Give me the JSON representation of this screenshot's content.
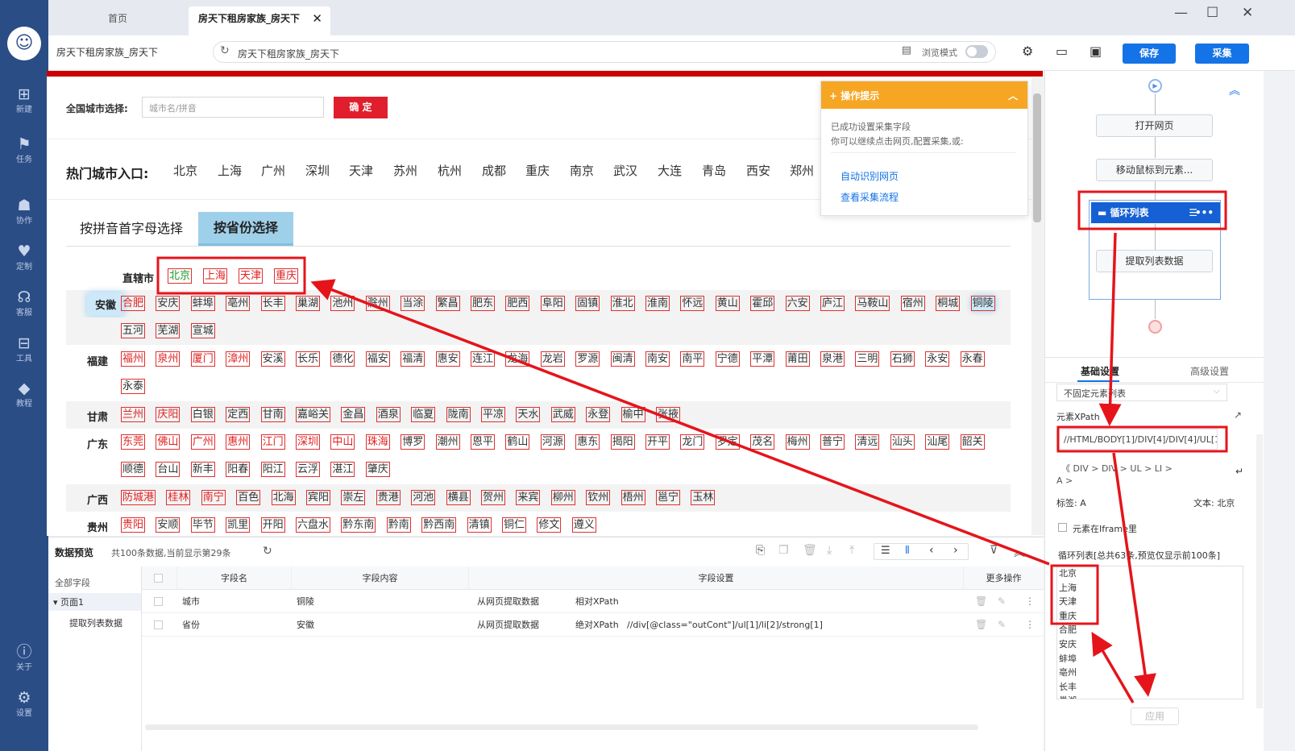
{
  "app": {
    "rail": [
      {
        "icon": "new-icon",
        "glyph": "⊞",
        "label": "新建"
      },
      {
        "icon": "task-icon",
        "glyph": "⚑",
        "label": "任务"
      },
      {
        "icon": "collab-icon",
        "glyph": "☗",
        "label": "协作"
      },
      {
        "icon": "custom-icon",
        "glyph": "♥",
        "label": "定制"
      },
      {
        "icon": "support-icon",
        "glyph": "☊",
        "label": "客服"
      },
      {
        "icon": "tools-icon",
        "glyph": "⊟",
        "label": "工具"
      },
      {
        "icon": "tutorial-icon",
        "glyph": "◆",
        "label": "教程"
      },
      {
        "icon": "about-icon",
        "glyph": "ⓘ",
        "label": "关于"
      },
      {
        "icon": "settings-icon",
        "glyph": "⚙",
        "label": "设置"
      }
    ],
    "tabs": [
      {
        "label": "首页"
      },
      {
        "label": "房天下租房家族_房天下"
      }
    ],
    "page_name": "房天下租房家族_房天下",
    "url_text": "房天下租房家族_房天下",
    "browse_mode_label": "浏览模式",
    "save_label": "保存",
    "collect_label": "采集"
  },
  "web": {
    "city_select_label": "全国城市选择:",
    "city_input_placeholder": "城市名/拼音",
    "confirm_label": "确 定",
    "hot_title": "热门城市入口:",
    "hot_cities": [
      "北京",
      "上海",
      "广州",
      "深圳",
      "天津",
      "苏州",
      "杭州",
      "成都",
      "重庆",
      "南京",
      "武汉",
      "大连",
      "青岛",
      "西安",
      "郑州"
    ],
    "tab_pinyin": "按拼音首字母选择",
    "tab_province": "按省份选择",
    "provinces": [
      {
        "name": "直辖市",
        "cities": [
          "北京",
          "上海",
          "天津",
          "重庆"
        ]
      },
      {
        "name": "安徽",
        "cities": [
          "合肥",
          "安庆",
          "蚌埠",
          "亳州",
          "长丰",
          "巢湖",
          "池州",
          "滁州",
          "当涂",
          "繁昌",
          "肥东",
          "肥西",
          "阜阳",
          "固镇",
          "淮北",
          "淮南",
          "怀远",
          "黄山",
          "霍邱",
          "六安",
          "庐江",
          "马鞍山",
          "宿州",
          "桐城",
          "铜陵",
          "五河",
          "芜湖",
          "宣城"
        ]
      },
      {
        "name": "福建",
        "cities": [
          "福州",
          "泉州",
          "厦门",
          "漳州",
          "安溪",
          "长乐",
          "德化",
          "福安",
          "福清",
          "惠安",
          "连江",
          "龙海",
          "龙岩",
          "罗源",
          "闽清",
          "南安",
          "南平",
          "宁德",
          "平潭",
          "莆田",
          "泉港",
          "三明",
          "石狮",
          "永安",
          "永春",
          "永泰"
        ]
      },
      {
        "name": "甘肃",
        "cities": [
          "兰州",
          "庆阳",
          "白银",
          "定西",
          "甘南",
          "嘉峪关",
          "金昌",
          "酒泉",
          "临夏",
          "陇南",
          "平凉",
          "天水",
          "武威",
          "永登",
          "榆中",
          "张掖"
        ]
      },
      {
        "name": "广东",
        "cities": [
          "东莞",
          "佛山",
          "广州",
          "惠州",
          "江门",
          "深圳",
          "中山",
          "珠海",
          "博罗",
          "潮州",
          "恩平",
          "鹤山",
          "河源",
          "惠东",
          "揭阳",
          "开平",
          "龙门",
          "罗定",
          "茂名",
          "梅州",
          "普宁",
          "清远",
          "汕头",
          "汕尾",
          "韶关",
          "顺德",
          "台山",
          "新丰",
          "阳春",
          "阳江",
          "云浮",
          "湛江",
          "肇庆"
        ]
      },
      {
        "name": "广西",
        "cities": [
          "防城港",
          "桂林",
          "南宁",
          "百色",
          "北海",
          "宾阳",
          "崇左",
          "贵港",
          "河池",
          "横县",
          "贺州",
          "来宾",
          "柳州",
          "钦州",
          "梧州",
          "邕宁",
          "玉林"
        ]
      },
      {
        "name": "贵州",
        "cities": [
          "贵阳",
          "安顺",
          "毕节",
          "凯里",
          "开阳",
          "六盘水",
          "黔东南",
          "黔南",
          "黔西南",
          "清镇",
          "铜仁",
          "修文",
          "遵义"
        ]
      }
    ]
  },
  "tip": {
    "title": "操作提示",
    "line1": "已成功设置采集字段",
    "line2": "你可以继续点击网页,配置采集,或:",
    "link1": "自动识别网页",
    "link2": "查看采集流程"
  },
  "flow": {
    "node_open": "打开网页",
    "node_move": "移动鼠标到元素...",
    "node_loop": "循环列表",
    "node_extract": "提取列表数据"
  },
  "panel": {
    "tab_basic": "基础设置",
    "tab_advanced": "高级设置",
    "loop_mode": "不固定元素列表",
    "xpath_label": "元素XPath",
    "xpath_value": "//HTML/BODY[1]/DIV[4]/DIV[4]/UL[1",
    "crumbs": "《 DIV  >  DIV  >  UL  >  LI  >",
    "crumb_last": "A  >",
    "tag_label": "标签: A",
    "text_label": "文本: 北京",
    "iframe_label": "元素在Iframe里",
    "loop_list_label": "循环列表[总共63条,预览仅显示前100条]",
    "loop_items": [
      "北京",
      "上海",
      "天津",
      "重庆",
      "合肥",
      "安庆",
      "蚌埠",
      "亳州",
      "长丰",
      "巢湖"
    ],
    "apply_label": "应用"
  },
  "preview": {
    "title": "数据预览",
    "info": "共100条数据,当前显示第29条",
    "all_fields": "全部字段",
    "page1": "页面1",
    "sub_item": "提取列表数据",
    "headers": {
      "field_name": "字段名",
      "field_content": "字段内容",
      "field_setting": "字段设置",
      "more": "更多操作"
    },
    "rows": [
      {
        "name": "城市",
        "content": "铜陵",
        "source": "从网页提取数据",
        "xpath_type": "相对XPath",
        "xpath": ""
      },
      {
        "name": "省份",
        "content": "安徽",
        "source": "从网页提取数据",
        "xpath_type": "绝对XPath",
        "xpath": "//div[@class=\"outCont\"]/ul[1]/li[2]/strong[1]"
      }
    ]
  },
  "colors": {
    "rail": "#2b4d86",
    "accent": "#1473e6",
    "site_red": "#e01e2d",
    "tip_orange": "#f6a623",
    "annot_red": "#e5141b"
  }
}
